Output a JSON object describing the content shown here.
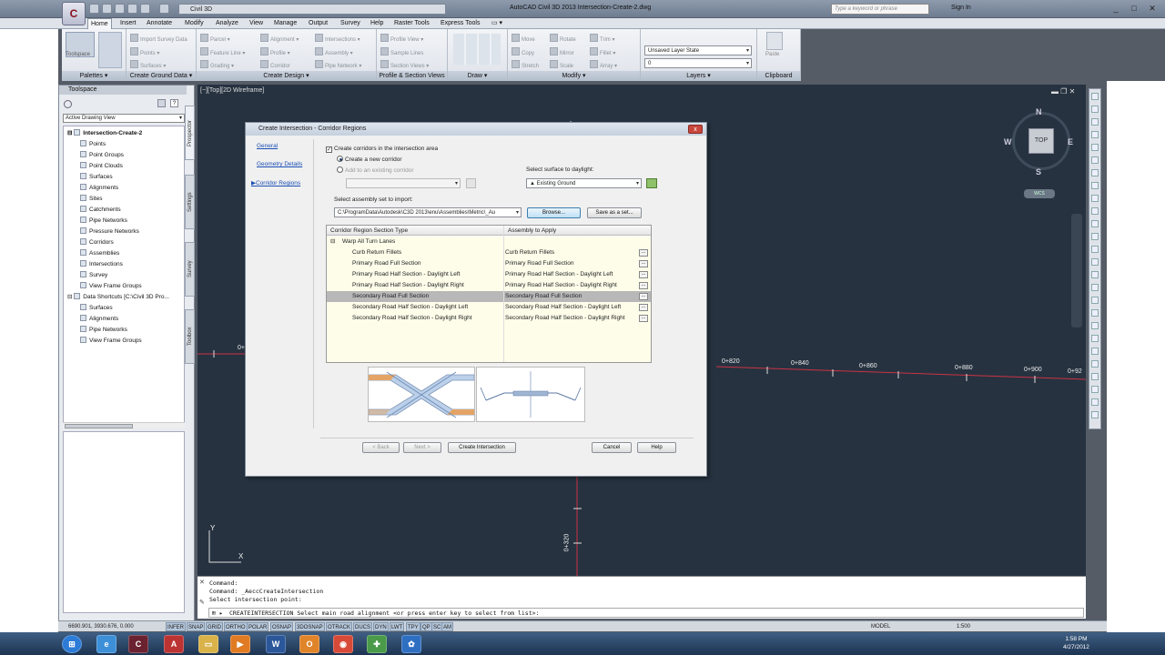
{
  "window": {
    "title": "AutoCAD Civil 3D 2013    Intersection-Create-2.dwg",
    "app_button_label": "C",
    "workspace": "Civil 3D",
    "search_placeholder": "Type a keyword or phrase",
    "sign_in": "Sign In",
    "min": "_",
    "max": "□",
    "close": "✕"
  },
  "menu": [
    "Home",
    "Insert",
    "Annotate",
    "Modify",
    "Analyze",
    "View",
    "Manage",
    "Output",
    "Survey",
    "Help",
    "Raster Tools",
    "Express Tools",
    "▭ ▾"
  ],
  "ribbon": {
    "panels": [
      {
        "caption": "Palettes ▾",
        "items": []
      },
      {
        "caption": "Create Ground Data ▾",
        "items": [
          "Import Survey Data",
          "Points ▾",
          "Surfaces ▾"
        ]
      },
      {
        "caption": "Create Design ▾",
        "items": [
          "Parcel ▾",
          "Feature Line ▾",
          "Grading ▾",
          "Alignment ▾",
          "Profile ▾",
          "Corridor",
          "Intersections ▾",
          "Assembly ▾",
          "Pipe Network ▾"
        ]
      },
      {
        "caption": "Profile & Section Views",
        "items": [
          "Profile View ▾",
          "Sample Lines",
          "Section Views ▾"
        ]
      },
      {
        "caption": "Draw ▾",
        "items": []
      },
      {
        "caption": "Modify ▾",
        "items": [
          "Move",
          "Copy",
          "Stretch",
          "Rotate",
          "Mirror",
          "Scale",
          "Trim ▾",
          "Fillet ▾",
          "Array ▾"
        ]
      },
      {
        "caption": "Layers ▾",
        "items": [
          "Unsaved Layer State",
          "0"
        ]
      },
      {
        "caption": "Clipboard",
        "items": [
          "Paste"
        ]
      }
    ],
    "toolspace_label": "Toolspace"
  },
  "viewport": {
    "label": "[−][Top][2D Wireframe]",
    "viewcube": {
      "n": "N",
      "s": "S",
      "e": "E",
      "w": "W",
      "top": "TOP",
      "wcs": "WCS"
    },
    "stations_h": [
      "0+820",
      "0+840",
      "0+860",
      "0+880",
      "0+900",
      "0+92"
    ],
    "stations_v": [
      "0+320"
    ],
    "left_station": "0+",
    "ucs_x": "X",
    "ucs_y": "Y"
  },
  "toolspace": {
    "title": "Toolspace",
    "view_combo": "Active Drawing View",
    "tabs": [
      "Prospector",
      "Settings",
      "Survey",
      "Toolbox"
    ],
    "tree": [
      {
        "label": "Intersection-Create-2",
        "level": 0,
        "bold": true
      },
      {
        "label": "Points",
        "level": 1
      },
      {
        "label": "Point Groups",
        "level": 1
      },
      {
        "label": "Point Clouds",
        "level": 1
      },
      {
        "label": "Surfaces",
        "level": 1
      },
      {
        "label": "Alignments",
        "level": 1
      },
      {
        "label": "Sites",
        "level": 1
      },
      {
        "label": "Catchments",
        "level": 1
      },
      {
        "label": "Pipe Networks",
        "level": 1
      },
      {
        "label": "Pressure Networks",
        "level": 1
      },
      {
        "label": "Corridors",
        "level": 1
      },
      {
        "label": "Assemblies",
        "level": 1
      },
      {
        "label": "Intersections",
        "level": 1
      },
      {
        "label": "Survey",
        "level": 1
      },
      {
        "label": "View Frame Groups",
        "level": 1
      },
      {
        "label": "Data Shortcuts [C:\\Civil 3D Pro...",
        "level": 0
      },
      {
        "label": "Surfaces",
        "level": 1
      },
      {
        "label": "Alignments",
        "level": 1
      },
      {
        "label": "Pipe Networks",
        "level": 1
      },
      {
        "label": "View Frame Groups",
        "level": 1
      }
    ]
  },
  "dialog": {
    "title": "Create Intersection - Corridor Regions",
    "close": "x",
    "nav": [
      "General",
      "Geometry Details",
      "Corridor Regions"
    ],
    "create_corridors": "Create corridors in the intersection area",
    "opt_new": "Create a new corridor",
    "opt_existing": "Add to an existing corridor",
    "surface_label": "Select surface to daylight:",
    "surface_value": "Existing Ground",
    "assembly_label": "Select assembly set to import:",
    "assembly_value": "C:\\ProgramData\\Autodesk\\C3D 2013\\enu\\Assemblies\\Metric\\_Au",
    "browse": "Browse...",
    "save_set": "Save as a set...",
    "grid": {
      "col1": "Corridor Region Section Type",
      "col2": "Assembly to Apply",
      "group": "Warp All Turn Lanes",
      "rows": [
        {
          "type": "Curb Return Fillets",
          "assembly": "Curb Return Fillets"
        },
        {
          "type": "Primary Road Full Section",
          "assembly": "Primary Road Full Section"
        },
        {
          "type": "Primary Road Half Section - Daylight Left",
          "assembly": "Primary Road Half Section - Daylight Left"
        },
        {
          "type": "Primary Road Half Section - Daylight Right",
          "assembly": "Primary Road Half Section - Daylight Right"
        },
        {
          "type": "Secondary Road Full Section",
          "assembly": "Secondary Road Full Section"
        },
        {
          "type": "Secondary Road Half Section - Daylight Left",
          "assembly": "Secondary Road Half Section - Daylight Left"
        },
        {
          "type": "Secondary Road Half Section - Daylight Right",
          "assembly": "Secondary Road Half Section - Daylight Right"
        }
      ],
      "selected_row": 4,
      "ellipsis": "..."
    },
    "buttons": {
      "back": "< Back",
      "next": "Next >",
      "create": "Create Intersection",
      "cancel": "Cancel",
      "help": "Help"
    }
  },
  "command": {
    "lines": [
      "Command:",
      "Command: _AeccCreateIntersection",
      "Select intersection point:"
    ],
    "prompt": "CREATEINTERSECTION Select main road alignment <or press enter key to select from list>:"
  },
  "status": {
    "coords": "6690.901, 3930.676, 0.000",
    "toggles": [
      "INFER",
      "SNAP",
      "GRID",
      "ORTHO",
      "POLAR",
      "OSNAP",
      "3DOSNAP",
      "OTRACK",
      "DUCS",
      "DYN",
      "LWT",
      "TPY",
      "QP",
      "SC",
      "AM"
    ],
    "model": "MODEL",
    "scale": "1:500"
  },
  "taskbar": {
    "time": "1:58 PM",
    "date": "4/27/2012"
  },
  "colors": {
    "canvas": "#263240",
    "accent": "#1a4fb5",
    "alignment": "#cc3344",
    "grid_row": "#fdfdea",
    "selected": "#b8b8b8"
  }
}
